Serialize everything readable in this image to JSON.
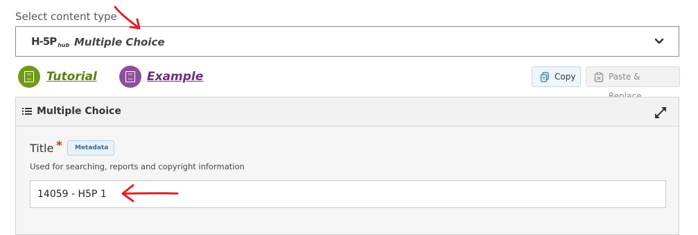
{
  "content_type": {
    "label": "Select content type",
    "logo_main": "H-5P",
    "logo_sub": "hub",
    "selected": "Multiple Choice"
  },
  "links": {
    "tutorial": "Tutorial",
    "example": "Example"
  },
  "toolbar": {
    "copy_label": "Copy",
    "paste_label": "Paste & Replace"
  },
  "editor": {
    "section_title": "Multiple Choice",
    "title_field": {
      "label": "Title",
      "required_mark": "*",
      "metadata_label": "Metadata",
      "description": "Used for searching, reports and copyright information",
      "value": "14059 - H5P 1"
    }
  },
  "colors": {
    "tutorial": "#6f9a17",
    "example": "#8c4f9b",
    "annotation_arrow": "#e02020"
  },
  "icons": {
    "dropdown": "chevron-down-icon",
    "copy": "copy-icon",
    "paste": "clipboard-icon",
    "section": "list-icon",
    "expand": "expand-icon"
  }
}
